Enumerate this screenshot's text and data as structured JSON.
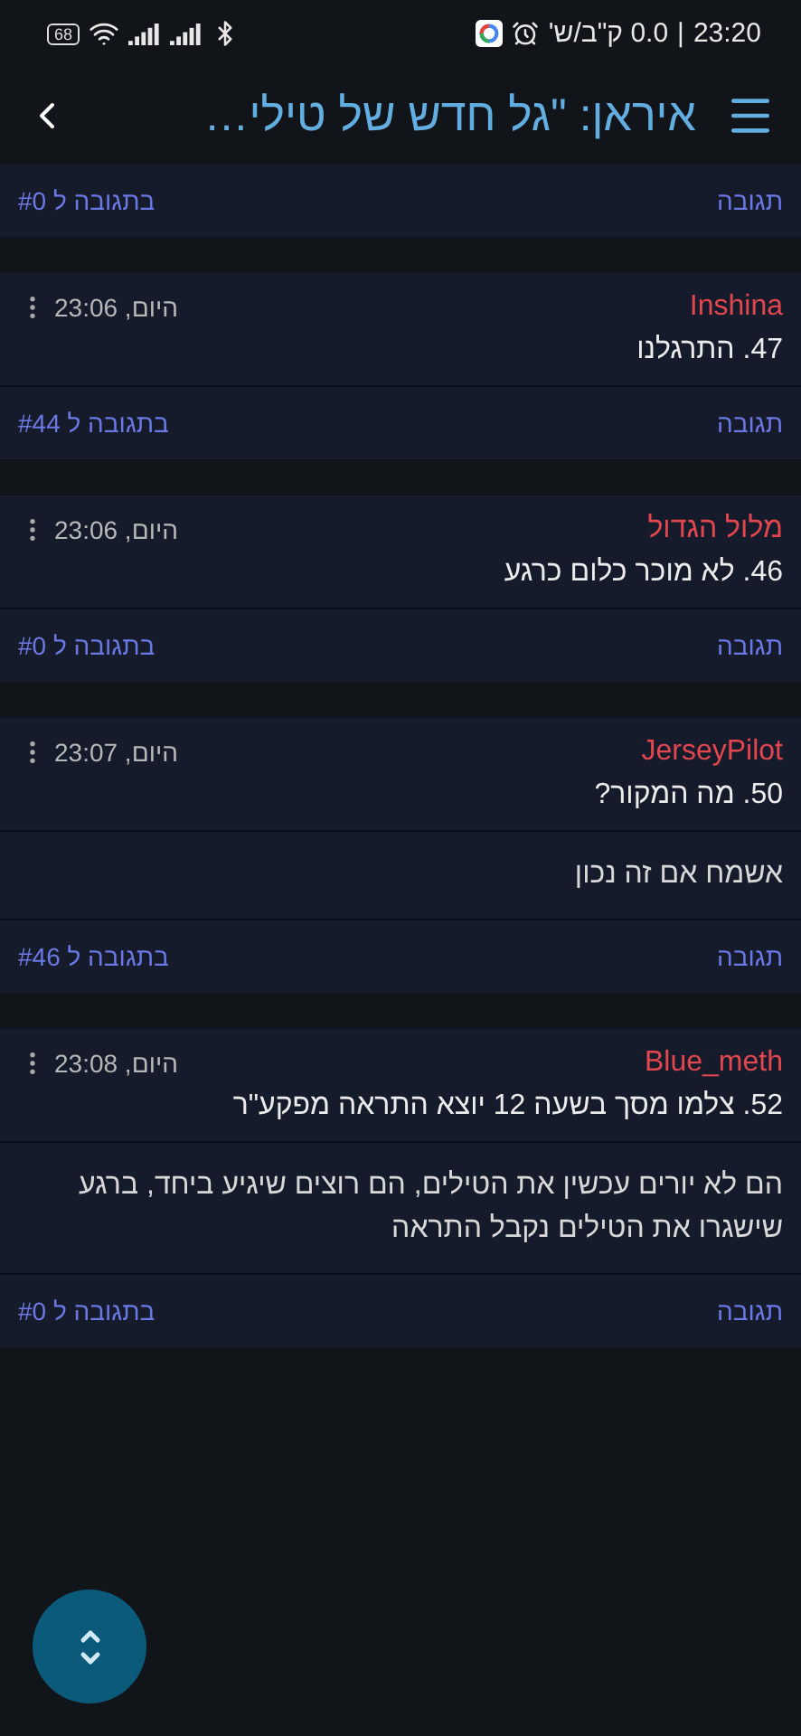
{
  "status_bar": {
    "time": "23:20",
    "separator": "|",
    "speed": "0.0 ק\"ב/ש'",
    "battery": "68"
  },
  "header": {
    "title": "איראן: \"גל חדש של טילי…"
  },
  "comments": [
    {
      "reply": "תגובה",
      "reply_to": "בתגובה ל #0"
    },
    {
      "author": "Inshina",
      "time": "היום, 23:06",
      "text": "47. התרגלנו",
      "reply": "תגובה",
      "reply_to": "בתגובה ל #44"
    },
    {
      "author": "מלול הגדול",
      "time": "היום, 23:06",
      "text": "46. לא מוכר כלום כרגע",
      "reply": "תגובה",
      "reply_to": "בתגובה ל #0"
    },
    {
      "author": "JerseyPilot",
      "time": "היום, 23:07",
      "text": "50. מה המקור?",
      "extra": [
        "אשמח אם זה נכון"
      ],
      "reply": "תגובה",
      "reply_to": "בתגובה ל #46"
    },
    {
      "author": "Blue_meth",
      "time": "היום, 23:08",
      "text": "52. צלמו מסך בשעה 12 יוצא התראה מפקע\"ר",
      "extra": [
        "הם לא יורים עכשין את הטילים, הם רוצים שיגיע ביחד, ברגע שישגרו את הטילים נקבל התראה"
      ],
      "reply": "תגובה",
      "reply_to": "בתגובה ל #0"
    }
  ]
}
